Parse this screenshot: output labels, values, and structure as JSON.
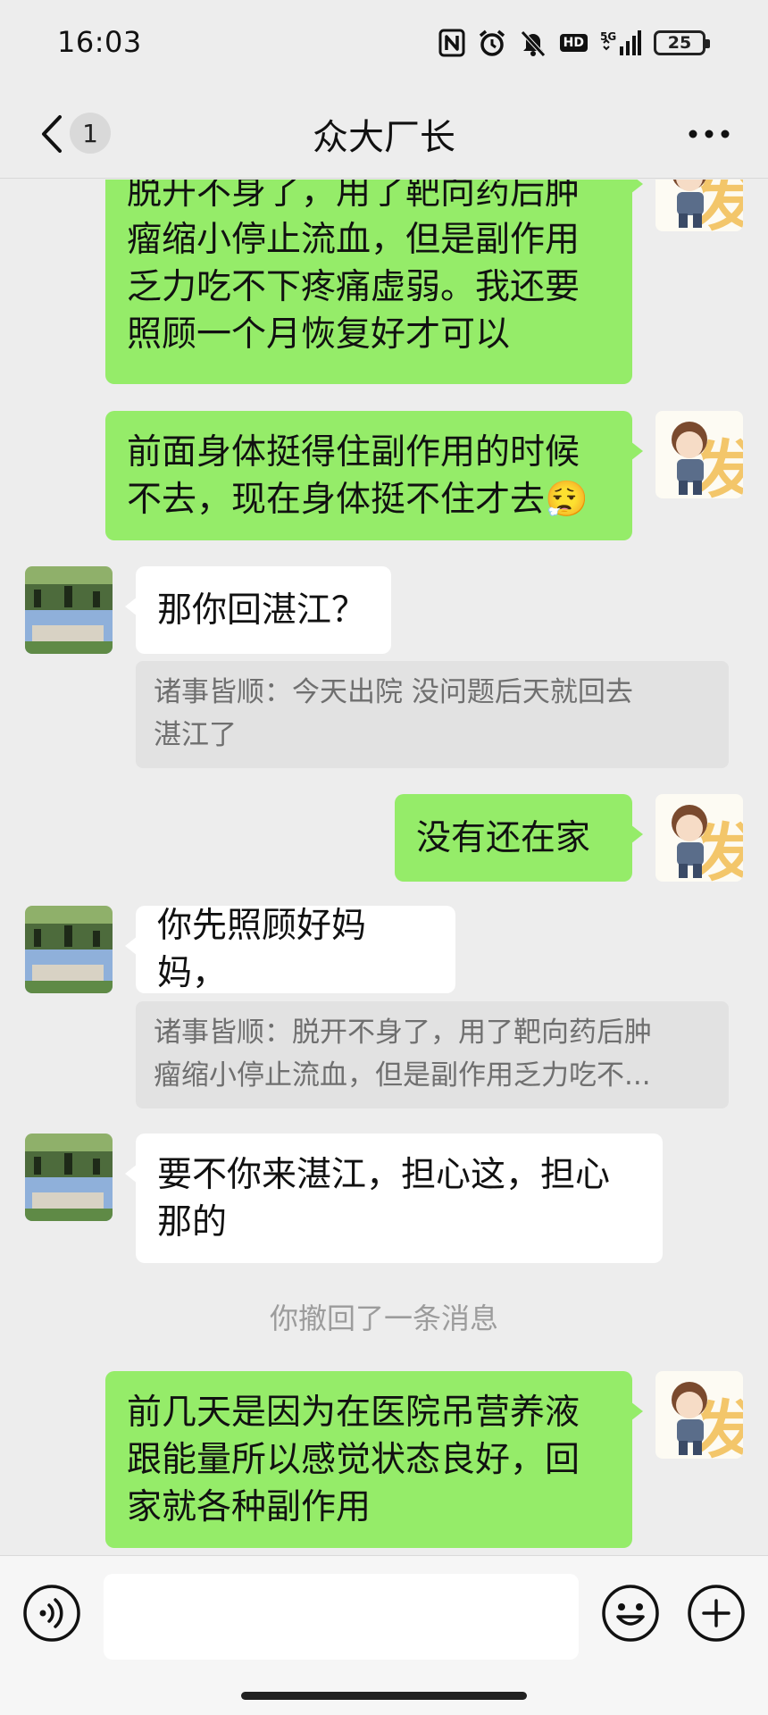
{
  "status_bar": {
    "time": "16:03",
    "battery": "25",
    "network": "5G",
    "hd": "HD",
    "icons": [
      "nfc-icon",
      "alarm-icon",
      "mute-icon",
      "hd-icon",
      "signal-icon",
      "battery-icon"
    ]
  },
  "nav": {
    "title": "众大厂长",
    "unread_count": "1",
    "icons": [
      "back-chevron-icon",
      "more-icon"
    ]
  },
  "messages": [
    {
      "from": "me",
      "lines": [
        "脱开不身了，用了靶向药后肿",
        "瘤缩小停止流血，但是副作用",
        "乏力吃不下疼痛虚弱。我还要",
        "照顾一个月恢复好才可以"
      ]
    },
    {
      "from": "me",
      "lines": [
        "前面身体挺得住副作用的时候",
        "不去，现在身体挺不住才去"
      ],
      "emoji": "😮‍💨"
    },
    {
      "from": "them",
      "lines": [
        "那你回湛江？"
      ],
      "quote": [
        "诸事皆顺：今天出院  没问题后天就回去",
        "湛江了"
      ]
    },
    {
      "from": "me",
      "lines": [
        "没有还在家"
      ]
    },
    {
      "from": "them",
      "lines": [
        "你先照顾好妈妈，"
      ],
      "quote": [
        "诸事皆顺：脱开不身了，用了靶向药后肿",
        "瘤缩小停止流血，但是副作用乏力吃不..."
      ]
    },
    {
      "from": "them",
      "lines": [
        "要不你来湛江，担心这，担心",
        "那的"
      ]
    },
    {
      "from": "me",
      "lines": [
        "前几天是因为在医院吊营养液",
        "跟能量所以感觉状态良好，回",
        "家就各种副作用"
      ]
    }
  ],
  "recall_notice": "你撤回了一条消息",
  "input_bar": {
    "placeholder": "",
    "icons": [
      "voice-icon",
      "emoji-icon",
      "plus-icon"
    ]
  },
  "colors": {
    "background": "#ededed",
    "my_bubble": "#95ec69",
    "their_bubble": "#ffffff",
    "quote_bg": "#e2e2e2"
  }
}
